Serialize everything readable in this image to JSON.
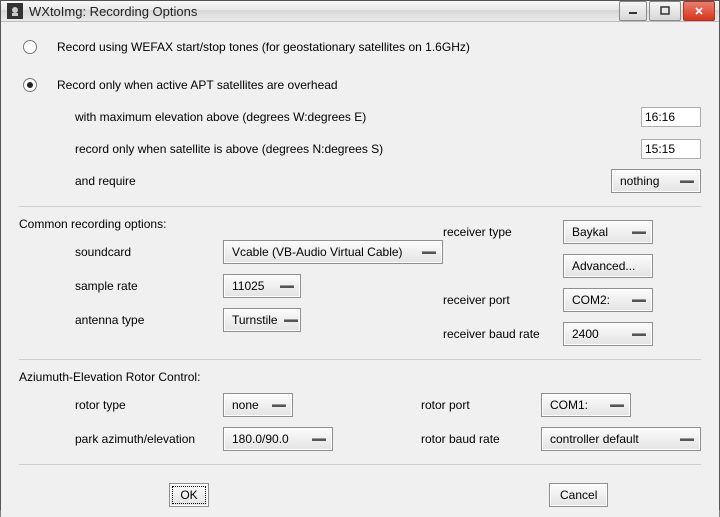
{
  "window": {
    "title": "WXtoImg: Recording Options"
  },
  "mode_wefax": {
    "label": "Record using WEFAX start/stop tones (for geostationary satellites on 1.6GHz)"
  },
  "mode_apt": {
    "label": "Record only when active APT satellites are overhead",
    "elev_label": "with maximum elevation above (degrees W:degrees E)",
    "elev_value": "16:16",
    "horizon_label": "record only when satellite is above (degrees N:degrees S)",
    "horizon_value": "15:15",
    "require_label": "and require",
    "require_value": "nothing"
  },
  "common": {
    "heading": "Common recording options:",
    "soundcard_label": "soundcard",
    "soundcard_value": "Vcable (VB-Audio Virtual Cable)",
    "sample_rate_label": "sample rate",
    "sample_rate_value": "11025",
    "antenna_label": "antenna type",
    "antenna_value": "Turnstile",
    "receiver_type_label": "receiver type",
    "receiver_type_value": "Baykal",
    "advanced_label": "Advanced...",
    "receiver_port_label": "receiver port",
    "receiver_port_value": "COM2:",
    "receiver_baud_label": "receiver baud rate",
    "receiver_baud_value": "2400"
  },
  "rotor": {
    "heading": "Aziumuth-Elevation Rotor Control:",
    "type_label": "rotor type",
    "type_value": "none",
    "park_label": "park azimuth/elevation",
    "park_value": "180.0/90.0",
    "port_label": "rotor port",
    "port_value": "COM1:",
    "baud_label": "rotor baud rate",
    "baud_value": "controller default"
  },
  "buttons": {
    "ok": "OK",
    "cancel": "Cancel"
  }
}
